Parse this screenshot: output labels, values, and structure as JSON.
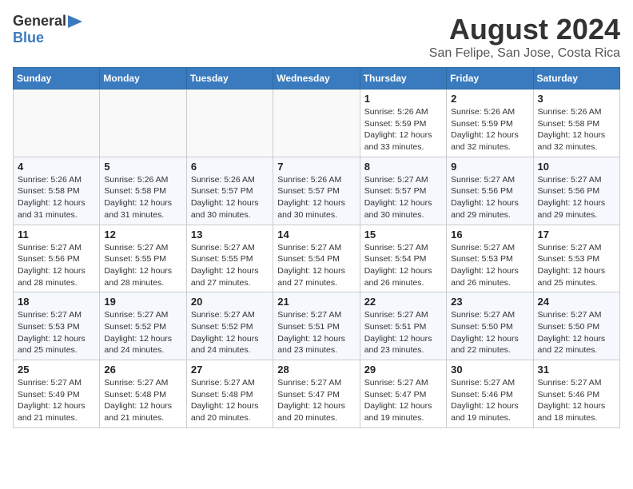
{
  "header": {
    "logo_general": "General",
    "logo_blue": "Blue",
    "title": "August 2024",
    "subtitle": "San Felipe, San Jose, Costa Rica"
  },
  "calendar": {
    "days_of_week": [
      "Sunday",
      "Monday",
      "Tuesday",
      "Wednesday",
      "Thursday",
      "Friday",
      "Saturday"
    ],
    "weeks": [
      [
        {
          "day": "",
          "info": ""
        },
        {
          "day": "",
          "info": ""
        },
        {
          "day": "",
          "info": ""
        },
        {
          "day": "",
          "info": ""
        },
        {
          "day": "1",
          "info": "Sunrise: 5:26 AM\nSunset: 5:59 PM\nDaylight: 12 hours and 33 minutes."
        },
        {
          "day": "2",
          "info": "Sunrise: 5:26 AM\nSunset: 5:59 PM\nDaylight: 12 hours and 32 minutes."
        },
        {
          "day": "3",
          "info": "Sunrise: 5:26 AM\nSunset: 5:58 PM\nDaylight: 12 hours and 32 minutes."
        }
      ],
      [
        {
          "day": "4",
          "info": "Sunrise: 5:26 AM\nSunset: 5:58 PM\nDaylight: 12 hours and 31 minutes."
        },
        {
          "day": "5",
          "info": "Sunrise: 5:26 AM\nSunset: 5:58 PM\nDaylight: 12 hours and 31 minutes."
        },
        {
          "day": "6",
          "info": "Sunrise: 5:26 AM\nSunset: 5:57 PM\nDaylight: 12 hours and 30 minutes."
        },
        {
          "day": "7",
          "info": "Sunrise: 5:26 AM\nSunset: 5:57 PM\nDaylight: 12 hours and 30 minutes."
        },
        {
          "day": "8",
          "info": "Sunrise: 5:27 AM\nSunset: 5:57 PM\nDaylight: 12 hours and 30 minutes."
        },
        {
          "day": "9",
          "info": "Sunrise: 5:27 AM\nSunset: 5:56 PM\nDaylight: 12 hours and 29 minutes."
        },
        {
          "day": "10",
          "info": "Sunrise: 5:27 AM\nSunset: 5:56 PM\nDaylight: 12 hours and 29 minutes."
        }
      ],
      [
        {
          "day": "11",
          "info": "Sunrise: 5:27 AM\nSunset: 5:56 PM\nDaylight: 12 hours and 28 minutes."
        },
        {
          "day": "12",
          "info": "Sunrise: 5:27 AM\nSunset: 5:55 PM\nDaylight: 12 hours and 28 minutes."
        },
        {
          "day": "13",
          "info": "Sunrise: 5:27 AM\nSunset: 5:55 PM\nDaylight: 12 hours and 27 minutes."
        },
        {
          "day": "14",
          "info": "Sunrise: 5:27 AM\nSunset: 5:54 PM\nDaylight: 12 hours and 27 minutes."
        },
        {
          "day": "15",
          "info": "Sunrise: 5:27 AM\nSunset: 5:54 PM\nDaylight: 12 hours and 26 minutes."
        },
        {
          "day": "16",
          "info": "Sunrise: 5:27 AM\nSunset: 5:53 PM\nDaylight: 12 hours and 26 minutes."
        },
        {
          "day": "17",
          "info": "Sunrise: 5:27 AM\nSunset: 5:53 PM\nDaylight: 12 hours and 25 minutes."
        }
      ],
      [
        {
          "day": "18",
          "info": "Sunrise: 5:27 AM\nSunset: 5:53 PM\nDaylight: 12 hours and 25 minutes."
        },
        {
          "day": "19",
          "info": "Sunrise: 5:27 AM\nSunset: 5:52 PM\nDaylight: 12 hours and 24 minutes."
        },
        {
          "day": "20",
          "info": "Sunrise: 5:27 AM\nSunset: 5:52 PM\nDaylight: 12 hours and 24 minutes."
        },
        {
          "day": "21",
          "info": "Sunrise: 5:27 AM\nSunset: 5:51 PM\nDaylight: 12 hours and 23 minutes."
        },
        {
          "day": "22",
          "info": "Sunrise: 5:27 AM\nSunset: 5:51 PM\nDaylight: 12 hours and 23 minutes."
        },
        {
          "day": "23",
          "info": "Sunrise: 5:27 AM\nSunset: 5:50 PM\nDaylight: 12 hours and 22 minutes."
        },
        {
          "day": "24",
          "info": "Sunrise: 5:27 AM\nSunset: 5:50 PM\nDaylight: 12 hours and 22 minutes."
        }
      ],
      [
        {
          "day": "25",
          "info": "Sunrise: 5:27 AM\nSunset: 5:49 PM\nDaylight: 12 hours and 21 minutes."
        },
        {
          "day": "26",
          "info": "Sunrise: 5:27 AM\nSunset: 5:48 PM\nDaylight: 12 hours and 21 minutes."
        },
        {
          "day": "27",
          "info": "Sunrise: 5:27 AM\nSunset: 5:48 PM\nDaylight: 12 hours and 20 minutes."
        },
        {
          "day": "28",
          "info": "Sunrise: 5:27 AM\nSunset: 5:47 PM\nDaylight: 12 hours and 20 minutes."
        },
        {
          "day": "29",
          "info": "Sunrise: 5:27 AM\nSunset: 5:47 PM\nDaylight: 12 hours and 19 minutes."
        },
        {
          "day": "30",
          "info": "Sunrise: 5:27 AM\nSunset: 5:46 PM\nDaylight: 12 hours and 19 minutes."
        },
        {
          "day": "31",
          "info": "Sunrise: 5:27 AM\nSunset: 5:46 PM\nDaylight: 12 hours and 18 minutes."
        }
      ]
    ]
  }
}
